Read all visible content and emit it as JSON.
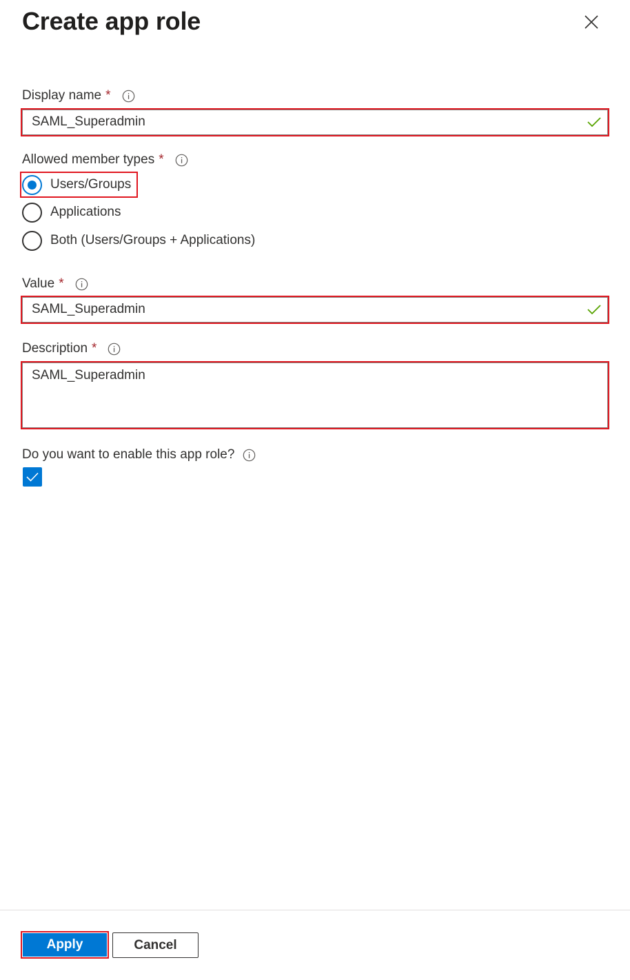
{
  "panel": {
    "title": "Create app role"
  },
  "form": {
    "display_name": {
      "label": "Display name",
      "required_mark": "*",
      "value": "SAML_Superadmin"
    },
    "member_types": {
      "label": "Allowed member types",
      "required_mark": "*",
      "options": [
        {
          "label": "Users/Groups",
          "selected": true
        },
        {
          "label": "Applications",
          "selected": false
        },
        {
          "label": "Both (Users/Groups + Applications)",
          "selected": false
        }
      ]
    },
    "value": {
      "label": "Value",
      "required_mark": "*",
      "value": "SAML_Superadmin"
    },
    "description": {
      "label": "Description",
      "required_mark": "*",
      "value": "SAML_Superadmin"
    },
    "enable": {
      "label": "Do you want to enable this app role?",
      "checked": true
    }
  },
  "footer": {
    "apply_label": "Apply",
    "cancel_label": "Cancel"
  },
  "colors": {
    "accent": "#0078d4",
    "highlight_border": "#e0161f",
    "required": "#a4262c",
    "valid_check": "#57a300"
  }
}
